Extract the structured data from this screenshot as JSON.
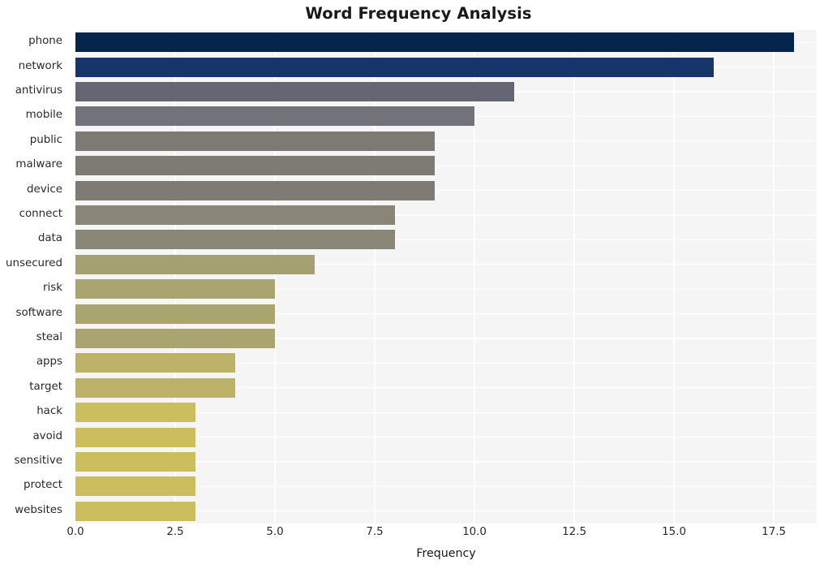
{
  "chart_data": {
    "type": "bar",
    "orientation": "horizontal",
    "title": "Word Frequency Analysis",
    "xlabel": "Frequency",
    "ylabel": "",
    "categories": [
      "phone",
      "network",
      "antivirus",
      "mobile",
      "public",
      "malware",
      "device",
      "connect",
      "data",
      "unsecured",
      "risk",
      "software",
      "steal",
      "apps",
      "target",
      "hack",
      "avoid",
      "sensitive",
      "protect",
      "websites"
    ],
    "values": [
      18,
      16,
      11,
      10,
      9,
      9,
      9,
      8,
      8,
      6,
      5,
      5,
      5,
      4,
      4,
      3,
      3,
      3,
      3,
      3
    ],
    "bar_colors": [
      "#04234d",
      "#17356b",
      "#646672",
      "#71727a",
      "#7b7a75",
      "#7d7b74",
      "#7d7b74",
      "#8a8677",
      "#8a8677",
      "#a5a072",
      "#aaa471",
      "#aaa471",
      "#aaa471",
      "#bcb369",
      "#bcb369",
      "#ccbe5f",
      "#ccbe5f",
      "#ccbe5f",
      "#ccbe5f",
      "#ccbe5f"
    ],
    "xticks": [
      "0.0",
      "2.5",
      "5.0",
      "7.5",
      "10.0",
      "12.5",
      "15.0",
      "17.5"
    ],
    "xtick_values": [
      0,
      2.5,
      5,
      7.5,
      10,
      12.5,
      15,
      17.5
    ],
    "xlim": [
      0,
      18.575
    ],
    "grid": true,
    "legend": null,
    "plot_background": "#f5f5f6",
    "figure_background": "#ffffff",
    "gridline_color": "#ffffff",
    "text_color": "#2a2a2a"
  }
}
